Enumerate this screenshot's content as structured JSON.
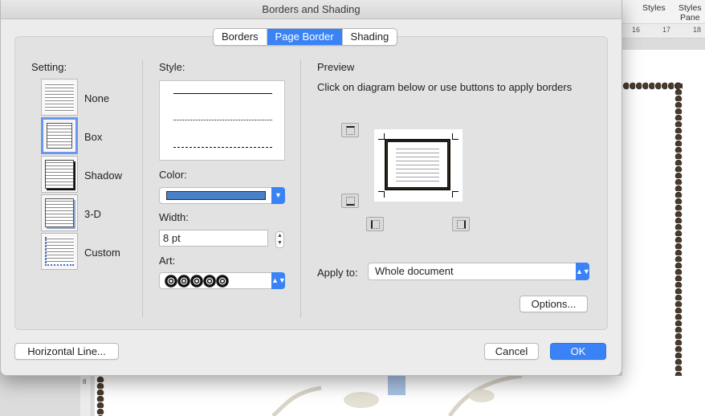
{
  "dialog": {
    "title": "Borders and Shading"
  },
  "tabs": [
    {
      "label": "Borders",
      "active": false
    },
    {
      "label": "Page Border",
      "active": true
    },
    {
      "label": "Shading",
      "active": false
    }
  ],
  "setting": {
    "label": "Setting:",
    "options": [
      {
        "label": "None",
        "icon": "setting-none-icon"
      },
      {
        "label": "Box",
        "icon": "setting-box-icon",
        "selected": true
      },
      {
        "label": "Shadow",
        "icon": "setting-shadow-icon"
      },
      {
        "label": "3-D",
        "icon": "setting-3d-icon"
      },
      {
        "label": "Custom",
        "icon": "setting-custom-icon"
      }
    ]
  },
  "style": {
    "label": "Style:",
    "options": [
      "solid",
      "dotted",
      "dashed"
    ]
  },
  "color": {
    "label": "Color:",
    "value": "#4a7fc9"
  },
  "width": {
    "label": "Width:",
    "value": "8 pt"
  },
  "art": {
    "label": "Art:",
    "selected": "black-ring-beads"
  },
  "preview": {
    "label": "Preview",
    "instruction": "Click on diagram below or use buttons to apply borders"
  },
  "apply_to": {
    "label": "Apply to:",
    "value": "Whole document"
  },
  "buttons": {
    "options": "Options...",
    "horizontal_line": "Horizontal Line...",
    "cancel": "Cancel",
    "ok": "OK"
  },
  "background": {
    "ribbon": {
      "styles": "Styles",
      "styles_pane_1": "Styles",
      "styles_pane_2": "Pane"
    },
    "ruler": [
      "16",
      "17",
      "18"
    ],
    "vruler": [
      "8"
    ]
  },
  "colors": {
    "accent": "#3a83f6",
    "border_art": "#1a130d"
  }
}
